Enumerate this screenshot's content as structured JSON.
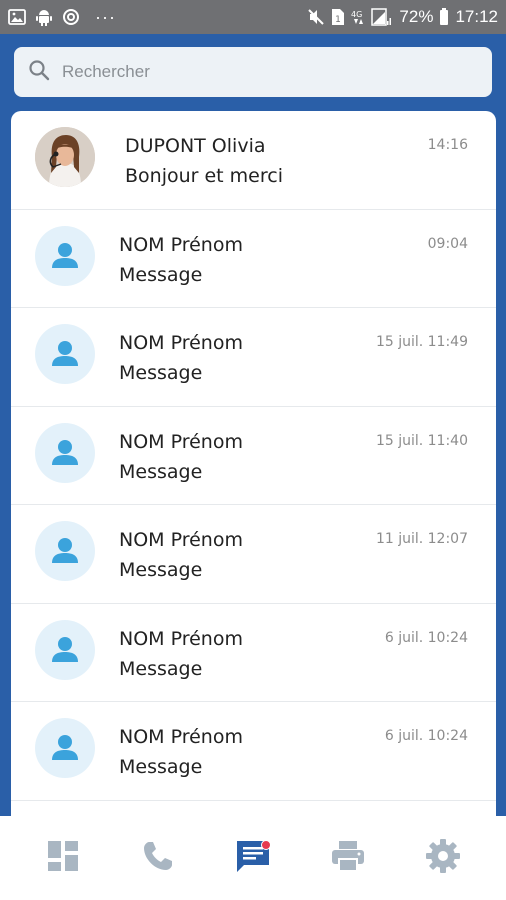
{
  "status_bar": {
    "battery": "72%",
    "time": "17:12",
    "overflow": "···"
  },
  "search": {
    "placeholder": "Rechercher",
    "icon": "search-icon"
  },
  "conversations": [
    {
      "name": "DUPONT Olivia",
      "message": "Bonjour et merci",
      "time": "14:16",
      "avatar": "photo"
    },
    {
      "name": "NOM Prénom",
      "message": "Message",
      "time": "09:04",
      "avatar": "person-icon"
    },
    {
      "name": "NOM Prénom",
      "message": "Message",
      "time": "15 juil. 11:49",
      "avatar": "person-icon"
    },
    {
      "name": "NOM Prénom",
      "message": "Message",
      "time": "15 juil. 11:40",
      "avatar": "person-icon"
    },
    {
      "name": "NOM Prénom",
      "message": "Message",
      "time": "11 juil. 12:07",
      "avatar": "person-icon"
    },
    {
      "name": "NOM Prénom",
      "message": "Message",
      "time": "6 juil. 10:24",
      "avatar": "person-icon"
    },
    {
      "name": "NOM Prénom",
      "message": "Message",
      "time": "6 juil. 10:24",
      "avatar": "person-icon"
    }
  ],
  "bottom_nav": [
    {
      "icon": "dashboard-icon",
      "active": false
    },
    {
      "icon": "phone-icon",
      "active": false
    },
    {
      "icon": "messages-icon",
      "active": true,
      "badge": true
    },
    {
      "icon": "printer-icon",
      "active": false
    },
    {
      "icon": "settings-gear-icon",
      "active": false
    }
  ],
  "colors": {
    "brand_blue": "#2a5fa8",
    "avatar_bg": "#e3f1fa",
    "avatar_fg": "#3ba3dc",
    "nav_inactive": "#a9b6c2",
    "nav_active": "#2a5fa8",
    "badge": "#e53950"
  }
}
